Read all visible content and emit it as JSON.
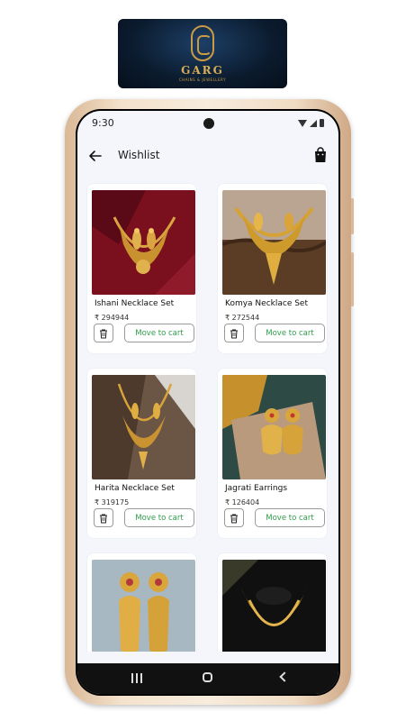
{
  "brand": {
    "name": "GARG",
    "tagline": "CHAINS & JEWELLERY"
  },
  "status_bar": {
    "time": "9:30"
  },
  "header": {
    "title": "Wishlist"
  },
  "actions": {
    "move_to_cart_label": "Move to cart"
  },
  "items": [
    {
      "name": "Ishani Necklace Set",
      "price": "₹ 294944"
    },
    {
      "name": "Komya Necklace Set",
      "price": "₹ 272544"
    },
    {
      "name": "Harita Necklace Set",
      "price": "₹ 319175"
    },
    {
      "name": "Jagrati Earrings",
      "price": "₹ 126404"
    },
    {
      "name": "",
      "price": ""
    },
    {
      "name": "",
      "price": ""
    }
  ],
  "colors": {
    "accent_green": "#2f9d4b",
    "gold": "#d8ae57"
  },
  "icons": [
    "back-arrow-icon",
    "shopping-bag-icon",
    "trash-icon",
    "recent-apps-icon",
    "home-icon",
    "nav-back-icon"
  ]
}
